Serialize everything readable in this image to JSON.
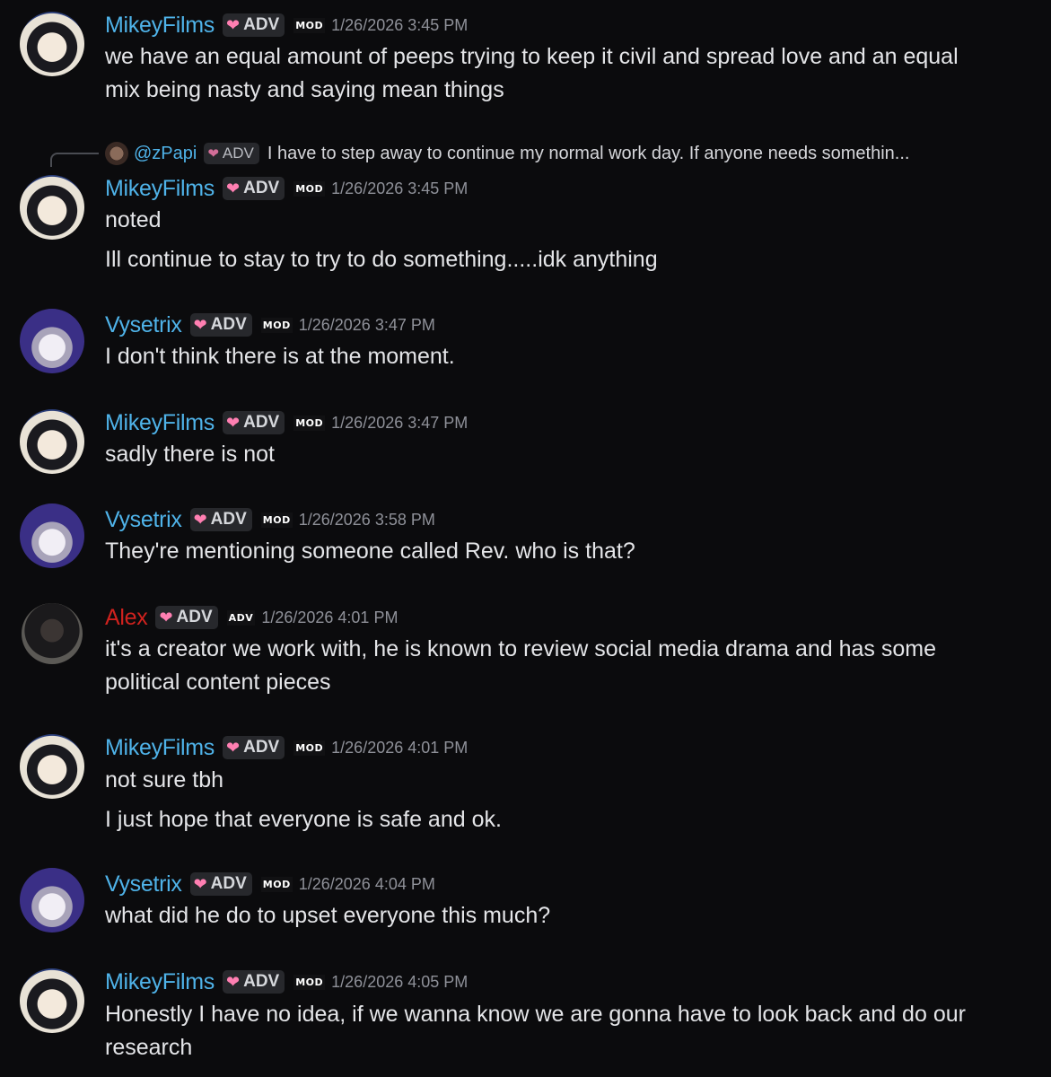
{
  "badge_label": "ADV",
  "colors": {
    "username": "#4fb3e9",
    "alex": "#d0221e",
    "background": "#0b0b0d",
    "heart": "#ff7fb2"
  },
  "reply": {
    "icon": "avatar-image",
    "name": "@zPapi",
    "badge": "ADV",
    "text": "I have to step away to continue my normal work day. If anyone needs somethin..."
  },
  "messages": [
    {
      "author": "MikeyFilms",
      "badge": "ADV",
      "tag": "MOD",
      "time": "1/26/2026 3:45 PM",
      "lines": [
        "we have an equal amount of peeps trying to keep it civil and spread love and an equal",
        "mix being nasty and saying mean things"
      ]
    },
    {
      "author": "MikeyFilms",
      "badge": "ADV",
      "tag": "MOD",
      "time": "1/26/2026 3:45 PM",
      "lines": [
        "noted",
        "Ill continue to stay to try to do something.....idk anything"
      ]
    },
    {
      "author": "Vysetrix",
      "badge": "ADV",
      "tag": "MOD",
      "time": "1/26/2026 3:47 PM",
      "lines": [
        "I don't think there is at the moment."
      ]
    },
    {
      "author": "MikeyFilms",
      "badge": "ADV",
      "tag": "MOD",
      "time": "1/26/2026 3:47 PM",
      "lines": [
        "sadly there is not"
      ]
    },
    {
      "author": "Vysetrix",
      "badge": "ADV",
      "tag": "MOD",
      "time": "1/26/2026 3:58 PM",
      "lines": [
        "They're mentioning someone called Rev. who is that?"
      ]
    },
    {
      "author": "Alex",
      "badge": "ADV",
      "tag": "ADV",
      "time": "1/26/2026 4:01 PM",
      "lines": [
        "it's a creator we work with, he is known to review social media drama and has some",
        "political content pieces"
      ]
    },
    {
      "author": "MikeyFilms",
      "badge": "ADV",
      "tag": "MOD",
      "time": "1/26/2026 4:01 PM",
      "lines": [
        "not sure tbh",
        "I just hope that everyone is safe and ok."
      ]
    },
    {
      "author": "Vysetrix",
      "badge": "ADV",
      "tag": "MOD",
      "time": "1/26/2026 4:04 PM",
      "lines": [
        "what did he do to upset everyone this much?"
      ]
    },
    {
      "author": "MikeyFilms",
      "badge": "ADV",
      "tag": "MOD",
      "time": "1/26/2026 4:05 PM",
      "lines": [
        "Honestly I have no idea, if we wanna know we are gonna have to look back and do our",
        "research"
      ]
    }
  ]
}
